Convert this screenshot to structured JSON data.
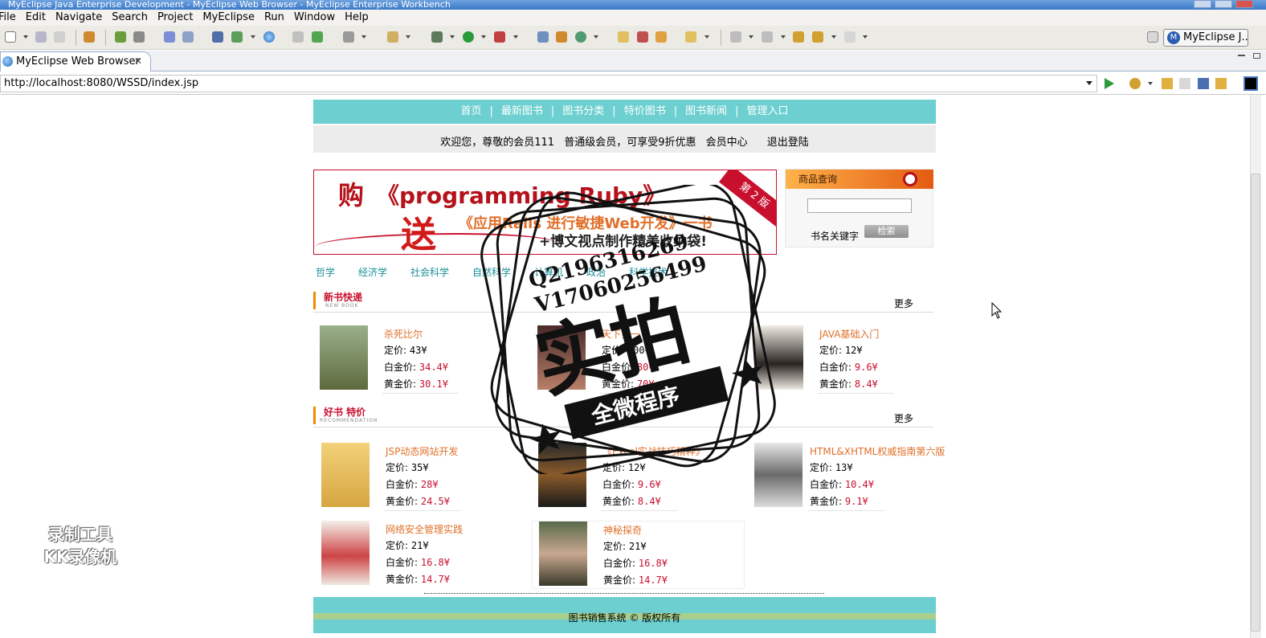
{
  "window": {
    "title": "MyEclipse Java Enterprise Development - MyEclipse Web Browser - MyEclipse Enterprise Workbench"
  },
  "menu": [
    "File",
    "Edit",
    "Navigate",
    "Search",
    "Project",
    "MyEclipse",
    "Run",
    "Window",
    "Help"
  ],
  "perspective": {
    "label": "MyEclipse J..."
  },
  "tab": {
    "label": "MyEclipse Web Browser",
    "close": "✕"
  },
  "browser": {
    "url": "http://localhost:8080/WSSD/index.jsp"
  },
  "site": {
    "nav": [
      "首页",
      "最新图书",
      "图书分类",
      "特价图书",
      "图书新闻",
      "管理入口"
    ],
    "nav_sep": "|",
    "welcome": {
      "greeting": "欢迎您，尊敬的会员111",
      "level": "普通级会员，可享受9折优惠",
      "center": "会员中心",
      "logout": "退出登陆"
    },
    "banner": {
      "buy": "购",
      "book": "《programming Ruby》",
      "send": "送",
      "rails": "《应用Rails 进行敏捷Web开发》一书",
      "bag": "+博文视点制作精美收纳袋!",
      "edition": "第 2 版"
    },
    "search": {
      "title": "商品查询",
      "label": "书名关键字",
      "button": "检索",
      "value": ""
    },
    "categories": [
      "哲学",
      "经济学",
      "社会科学",
      "自然科学",
      "计算机",
      "政治",
      "科学技术"
    ],
    "new_books": {
      "title": "新书快递",
      "subtitle": "NEW BOOK",
      "more": "更多",
      "items": [
        {
          "name": "杀死比尔",
          "list_label": "定价:",
          "list": "43¥",
          "platinum_label": "白金价:",
          "platinum": "34.4¥",
          "gold_label": "黄金价:",
          "gold": "30.1¥"
        },
        {
          "name": "天下第一",
          "list_label": "定价:",
          "list": "100¥",
          "platinum_label": "白金价:",
          "platinum": "80¥",
          "gold_label": "黄金价:",
          "gold": "70¥"
        },
        {
          "name": "JAVA基础入门",
          "list_label": "定价:",
          "list": "12¥",
          "platinum_label": "白金价:",
          "platinum": "9.6¥",
          "gold_label": "黄金价:",
          "gold": "8.4¥"
        }
      ]
    },
    "special_books": {
      "title": "好书 特价",
      "subtitle": "RECOMMENDATION",
      "more": "更多",
      "items": [
        {
          "name": "JSP动态网站开发",
          "list_label": "定价:",
          "list": "35¥",
          "platinum_label": "白金价:",
          "platinum": "28¥",
          "gold_label": "黄金价:",
          "gold": "24.5¥"
        },
        {
          "name": "《Excel实战技巧精粹》",
          "list_label": "定价:",
          "list": "12¥",
          "platinum_label": "白金价:",
          "platinum": "9.6¥",
          "gold_label": "黄金价:",
          "gold": "8.4¥"
        },
        {
          "name": "HTML&XHTML权威指南第六版",
          "list_label": "定价:",
          "list": "13¥",
          "platinum_label": "白金价:",
          "platinum": "10.4¥",
          "gold_label": "黄金价:",
          "gold": "9.1¥"
        },
        {
          "name": "网络安全管理实践",
          "list_label": "定价:",
          "list": "21¥",
          "platinum_label": "白金价:",
          "platinum": "16.8¥",
          "gold_label": "黄金价:",
          "gold": "14.7¥"
        },
        {
          "name": "神秘探奇",
          "list_label": "定价:",
          "list": "21¥",
          "platinum_label": "白金价:",
          "platinum": "16.8¥",
          "gold_label": "黄金价:",
          "gold": "14.7¥"
        }
      ]
    },
    "footer": "图书销售系统 © 版权所有"
  },
  "overlay": {
    "stamp_line1": "Q2196316269",
    "stamp_line2": "V17060256499",
    "stamp_main": "实拍",
    "stamp_ribbon": "全微程序",
    "recorder_line1": "录制工具",
    "recorder_line2": "KK录像机"
  },
  "colors": {
    "nav_bg": "#6dcfcf",
    "accent_red": "#c8102e",
    "book_title": "#e0702a",
    "category": "#1a8f9a"
  }
}
